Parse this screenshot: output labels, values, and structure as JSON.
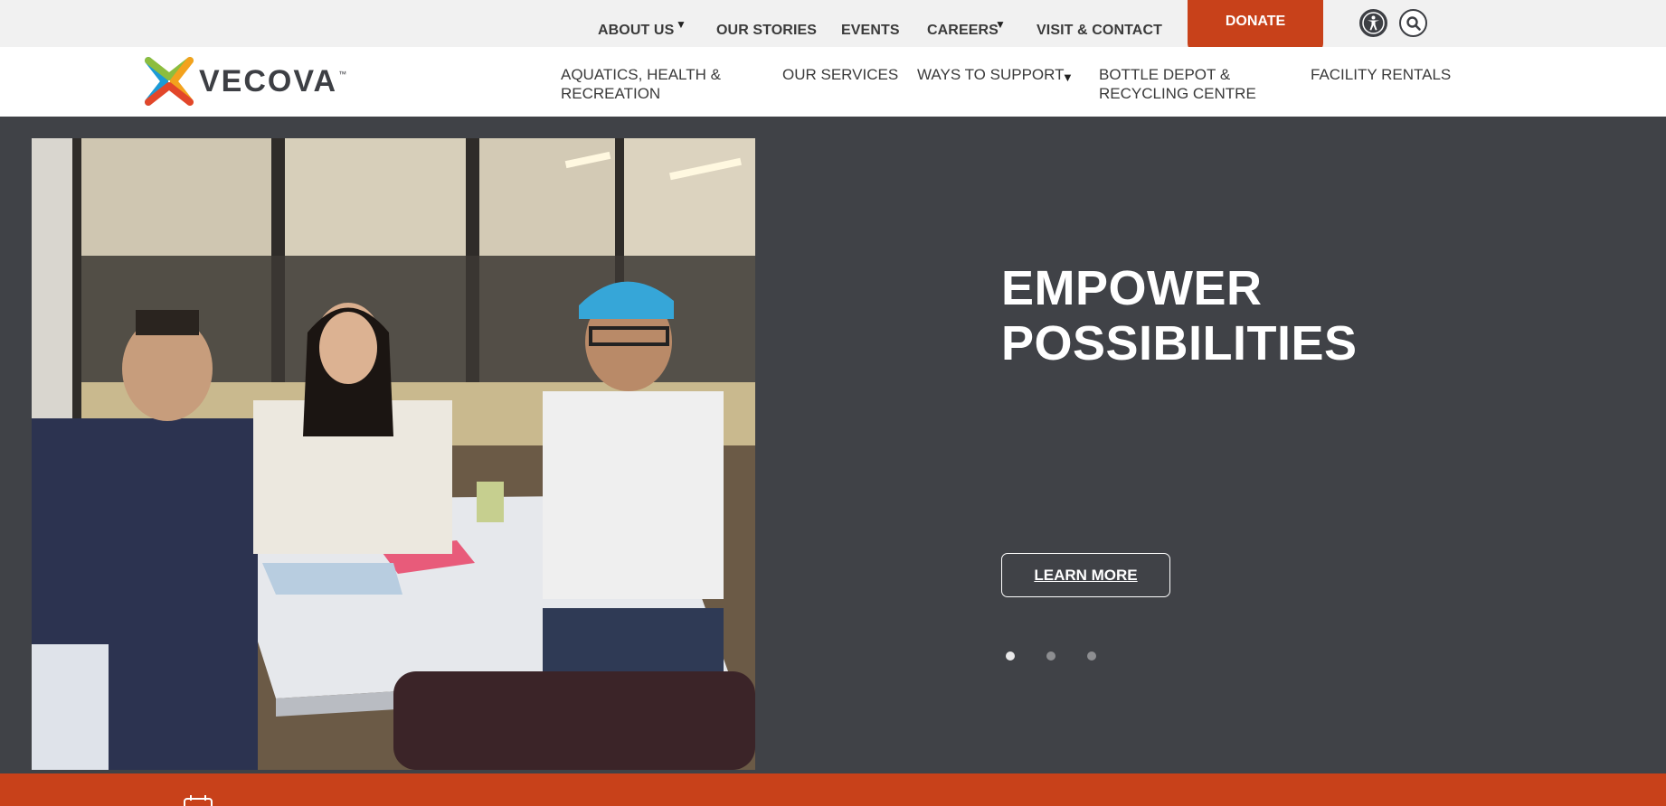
{
  "utility_nav": {
    "items": [
      {
        "label": "ABOUT US",
        "caret": "▼"
      },
      {
        "label": "OUR STORIES"
      },
      {
        "label": "EVENTS"
      },
      {
        "label": "CAREERS",
        "caret": "▼"
      },
      {
        "label": "VISIT & CONTACT"
      }
    ],
    "donate_label": "DONATE",
    "accessibility_icon": "accessibility-icon",
    "search_icon": "search-icon"
  },
  "brand": {
    "name": "VECOVA",
    "tm": "™",
    "colors": [
      "#1b9ad6",
      "#8cbd3f",
      "#f3a21d",
      "#e2462a"
    ]
  },
  "main_nav": {
    "items": [
      {
        "line1": "AQUATICS, HEALTH &",
        "line2": "RECREATION"
      },
      {
        "line1": "OUR SERVICES"
      },
      {
        "line1": "WAYS TO SUPPORT",
        "caret": "▼"
      },
      {
        "line1": "BOTTLE DEPOT &",
        "line2": "RECYCLING CENTRE"
      },
      {
        "line1": "FACILITY RENTALS"
      }
    ]
  },
  "hero": {
    "title_line1": "EMPOWER",
    "title_line2": "POSSIBILITIES",
    "cta_label": "LEARN MORE",
    "slides": 3,
    "active_slide": 1
  },
  "colors": {
    "accent": "#c8411a",
    "hero_bg": "#404247",
    "utility_bg": "#f1f1f1"
  },
  "footer_bar": {
    "icon": "calendar-icon"
  }
}
